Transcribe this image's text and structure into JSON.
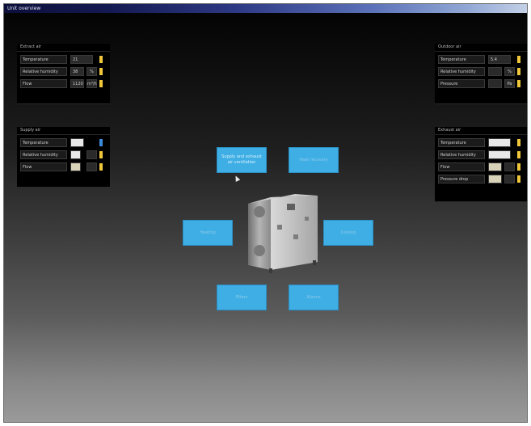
{
  "window": {
    "title": "Unit overview"
  },
  "panels": {
    "top_left": {
      "title": "Extract air",
      "rows": [
        {
          "label": "Temperature",
          "value": "21",
          "unit": ""
        },
        {
          "label": "Relative humidity",
          "value": "38",
          "unit": "%"
        },
        {
          "label": "Flow",
          "value": "1120",
          "unit": "m³/h"
        }
      ]
    },
    "mid_left": {
      "title": "Supply air",
      "rows": [
        {
          "label": "Temperature",
          "value": "",
          "unit": ""
        },
        {
          "label": "Relative humidity",
          "value": "",
          "unit": ""
        },
        {
          "label": "Flow",
          "value": "",
          "unit": ""
        }
      ]
    },
    "top_right": {
      "title": "Outdoor air",
      "rows": [
        {
          "label": "Temperature",
          "value": "5.4",
          "unit": ""
        },
        {
          "label": "Relative humidity",
          "value": "",
          "unit": "%"
        },
        {
          "label": "Pressure",
          "value": "",
          "unit": "Pa"
        }
      ]
    },
    "mid_right": {
      "title": "Exhaust air",
      "rows": [
        {
          "label": "Temperature",
          "value": "",
          "unit": ""
        },
        {
          "label": "Relative humidity",
          "value": "",
          "unit": ""
        },
        {
          "label": "Flow",
          "value": "",
          "unit": ""
        },
        {
          "label": "Pressure drop",
          "value": "",
          "unit": ""
        }
      ]
    }
  },
  "tiles": {
    "top_left": "Supply and exhaust air ventilation",
    "top_right": "Heat recovery",
    "mid_left": "Heating",
    "mid_right": "Cooling",
    "bottom_left": "Filters",
    "bottom_right": "Alarms"
  }
}
